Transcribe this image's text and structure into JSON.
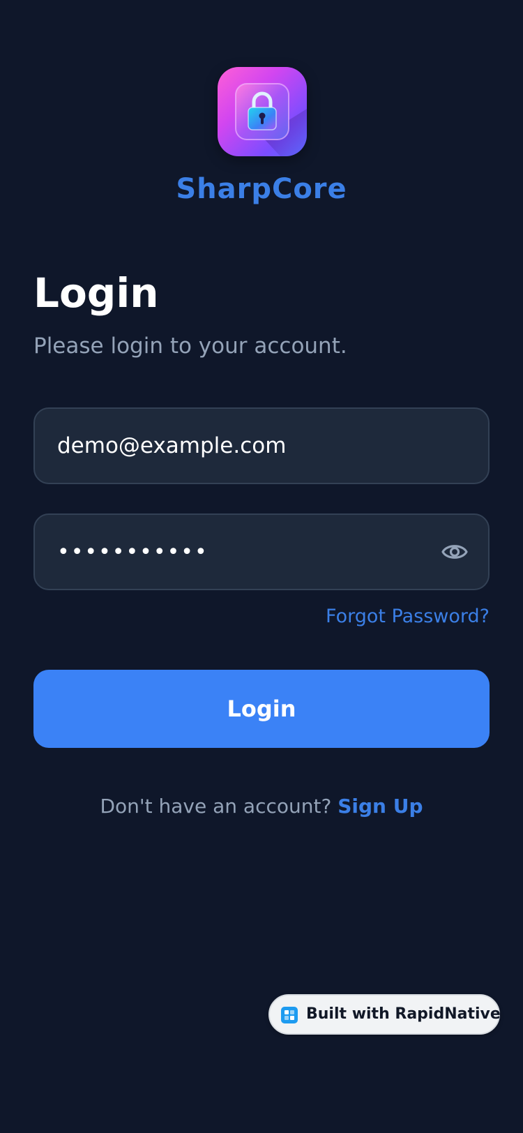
{
  "app": {
    "brand_name": "SharpCore",
    "logo_icon": "padlock-app-icon"
  },
  "login": {
    "title": "Login",
    "subtitle": "Please login to your account.",
    "email_value": "demo@example.com",
    "password_value": "•••••••••••",
    "password_toggle_icon": "eye-icon",
    "forgot_label": "Forgot Password?",
    "submit_label": "Login",
    "signup_prompt": "Don't have an account? ",
    "signup_link": "Sign Up"
  },
  "badge": {
    "label": "Built with RapidNative",
    "icon": "rapidnative-logo-icon"
  },
  "colors": {
    "background": "#0f172a",
    "field_bg": "#1e293b",
    "field_border": "#334155",
    "accent": "#3b82f6",
    "link": "#3b7fe6",
    "muted_text": "#94a3b8"
  }
}
